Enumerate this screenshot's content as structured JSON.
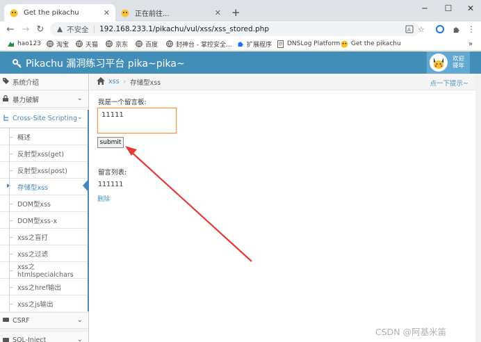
{
  "browser": {
    "tabs": [
      {
        "title": "Get the pikachu",
        "active": true,
        "icon": "pikachu-favicon"
      },
      {
        "title": "正在前往...",
        "active": false,
        "icon": "pikachu-favicon"
      }
    ],
    "new_tab_label": "+",
    "address": {
      "security_label": "不安全",
      "url": "192.168.233.1/pikachu/vul/xss/xss_stored.php"
    },
    "bookmarks": [
      {
        "label": "hao123",
        "icon": "hao123-icon"
      },
      {
        "label": "淘宝",
        "icon": "globe-icon"
      },
      {
        "label": "天猫",
        "icon": "globe-icon"
      },
      {
        "label": "京东",
        "icon": "globe-icon"
      },
      {
        "label": "百度",
        "icon": "globe-icon"
      },
      {
        "label": "封神台 - 掌控安全...",
        "icon": "globe-icon"
      },
      {
        "label": "扩展程序",
        "icon": "puzzle-icon"
      },
      {
        "label": "DNSLog Platform",
        "icon": "doc-icon"
      },
      {
        "label": "Get the pikachu",
        "icon": "pikachu-favicon"
      }
    ]
  },
  "app": {
    "title": "Pikachu 漏洞练习平台 pika~pika~",
    "welcome": "欢迎 驿年",
    "accent": "#438eb9"
  },
  "sidebar": {
    "sections": [
      {
        "label": "系统介绍",
        "icon": "tag-icon"
      },
      {
        "label": "暴力破解",
        "icon": "lock-icon"
      },
      {
        "label": "Cross-Site Scripting",
        "icon": "sitemap-icon"
      }
    ],
    "xss_items": [
      "概述",
      "反射型xss(get)",
      "反射型xss(post)",
      "存储型xss",
      "DOM型xss",
      "DOM型xss-x",
      "xss之盲打",
      "xss之过滤",
      "xss之htmlspecialchars",
      "xss之href输出",
      "xss之js输出"
    ],
    "bottom_sections": [
      {
        "label": "CSRF",
        "icon": "bolt-icon"
      },
      {
        "label": "SQL-Inject",
        "icon": "bolt-icon"
      }
    ]
  },
  "breadcrumb": {
    "root": "xss",
    "current": "存储型xss",
    "hint": "点一下提示~"
  },
  "main": {
    "form_label": "我是一个留言板:",
    "input_value": "11111",
    "submit_label": "submit",
    "list_label": "留言列表:",
    "messages": [
      {
        "text": "111111",
        "delete_label": "删除"
      }
    ]
  },
  "watermark": "CSDN @阿基米笛"
}
